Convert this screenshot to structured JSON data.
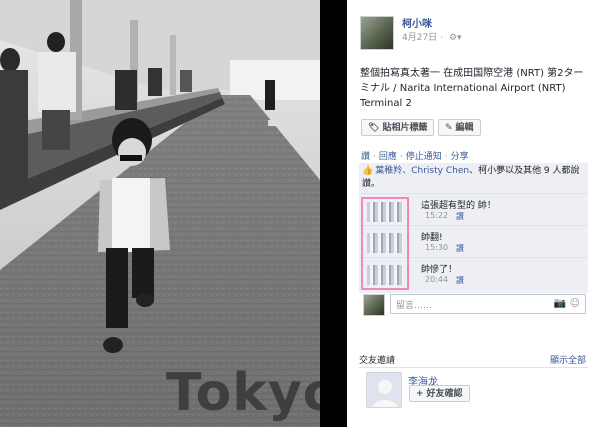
{
  "photo": {
    "overlay_text": "Tokyo"
  },
  "post": {
    "author": "柯小咪",
    "date": "4月27日",
    "separator": "·",
    "caption": "整個拍寫真太著一 在成田国際空港 (NRT) 第2ターミナル / Narita International Airport (NRT) Terminal 2",
    "tag_label": "貼相片標籤",
    "edit_label": "編輯",
    "actions": [
      "讚",
      "回應",
      "停止通知",
      "分享"
    ],
    "likes_text_prefix": "葉稚羚、",
    "likes_name2": "Christy Chen",
    "likes_text_mid": "、柯小夢以及其他 9 人都說讚。",
    "comments": [
      {
        "text": "這張超有型的 帥！",
        "time": "15:22",
        "reply": "讚"
      },
      {
        "text": "帥翻!",
        "time": "15:30",
        "reply": "讚"
      },
      {
        "text": "帥慘了！",
        "time": "20:44",
        "reply": "讚"
      }
    ],
    "reply_placeholder": "留言……"
  },
  "friend_requests": {
    "heading": "交友邀請",
    "see_all": "顯示全部",
    "name": "李海龙",
    "confirm_label": "好友確認"
  },
  "colors": {
    "link": "#3b5998",
    "likes_bg": "#edeff4",
    "highlight": "#f08cb4"
  },
  "icons": [
    "gear-icon",
    "tag-icon",
    "pencil-icon",
    "thumbs-up-icon",
    "camera-icon",
    "smiley-icon",
    "add-friend-icon"
  ]
}
